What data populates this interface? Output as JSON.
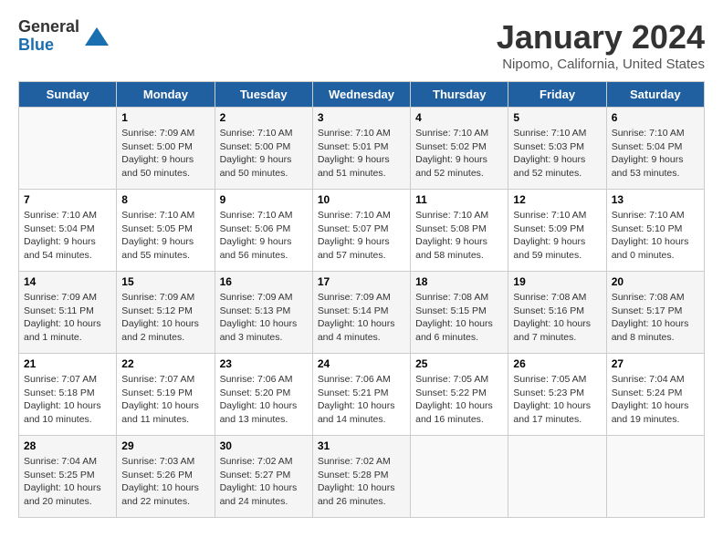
{
  "header": {
    "logo_general": "General",
    "logo_blue": "Blue",
    "month_title": "January 2024",
    "location": "Nipomo, California, United States"
  },
  "days_of_week": [
    "Sunday",
    "Monday",
    "Tuesday",
    "Wednesday",
    "Thursday",
    "Friday",
    "Saturday"
  ],
  "weeks": [
    [
      {
        "day": "",
        "sunrise": "",
        "sunset": "",
        "daylight": ""
      },
      {
        "day": "1",
        "sunrise": "Sunrise: 7:09 AM",
        "sunset": "Sunset: 5:00 PM",
        "daylight": "Daylight: 9 hours and 50 minutes."
      },
      {
        "day": "2",
        "sunrise": "Sunrise: 7:10 AM",
        "sunset": "Sunset: 5:00 PM",
        "daylight": "Daylight: 9 hours and 50 minutes."
      },
      {
        "day": "3",
        "sunrise": "Sunrise: 7:10 AM",
        "sunset": "Sunset: 5:01 PM",
        "daylight": "Daylight: 9 hours and 51 minutes."
      },
      {
        "day": "4",
        "sunrise": "Sunrise: 7:10 AM",
        "sunset": "Sunset: 5:02 PM",
        "daylight": "Daylight: 9 hours and 52 minutes."
      },
      {
        "day": "5",
        "sunrise": "Sunrise: 7:10 AM",
        "sunset": "Sunset: 5:03 PM",
        "daylight": "Daylight: 9 hours and 52 minutes."
      },
      {
        "day": "6",
        "sunrise": "Sunrise: 7:10 AM",
        "sunset": "Sunset: 5:04 PM",
        "daylight": "Daylight: 9 hours and 53 minutes."
      }
    ],
    [
      {
        "day": "7",
        "sunrise": "Sunrise: 7:10 AM",
        "sunset": "Sunset: 5:04 PM",
        "daylight": "Daylight: 9 hours and 54 minutes."
      },
      {
        "day": "8",
        "sunrise": "Sunrise: 7:10 AM",
        "sunset": "Sunset: 5:05 PM",
        "daylight": "Daylight: 9 hours and 55 minutes."
      },
      {
        "day": "9",
        "sunrise": "Sunrise: 7:10 AM",
        "sunset": "Sunset: 5:06 PM",
        "daylight": "Daylight: 9 hours and 56 minutes."
      },
      {
        "day": "10",
        "sunrise": "Sunrise: 7:10 AM",
        "sunset": "Sunset: 5:07 PM",
        "daylight": "Daylight: 9 hours and 57 minutes."
      },
      {
        "day": "11",
        "sunrise": "Sunrise: 7:10 AM",
        "sunset": "Sunset: 5:08 PM",
        "daylight": "Daylight: 9 hours and 58 minutes."
      },
      {
        "day": "12",
        "sunrise": "Sunrise: 7:10 AM",
        "sunset": "Sunset: 5:09 PM",
        "daylight": "Daylight: 9 hours and 59 minutes."
      },
      {
        "day": "13",
        "sunrise": "Sunrise: 7:10 AM",
        "sunset": "Sunset: 5:10 PM",
        "daylight": "Daylight: 10 hours and 0 minutes."
      }
    ],
    [
      {
        "day": "14",
        "sunrise": "Sunrise: 7:09 AM",
        "sunset": "Sunset: 5:11 PM",
        "daylight": "Daylight: 10 hours and 1 minute."
      },
      {
        "day": "15",
        "sunrise": "Sunrise: 7:09 AM",
        "sunset": "Sunset: 5:12 PM",
        "daylight": "Daylight: 10 hours and 2 minutes."
      },
      {
        "day": "16",
        "sunrise": "Sunrise: 7:09 AM",
        "sunset": "Sunset: 5:13 PM",
        "daylight": "Daylight: 10 hours and 3 minutes."
      },
      {
        "day": "17",
        "sunrise": "Sunrise: 7:09 AM",
        "sunset": "Sunset: 5:14 PM",
        "daylight": "Daylight: 10 hours and 4 minutes."
      },
      {
        "day": "18",
        "sunrise": "Sunrise: 7:08 AM",
        "sunset": "Sunset: 5:15 PM",
        "daylight": "Daylight: 10 hours and 6 minutes."
      },
      {
        "day": "19",
        "sunrise": "Sunrise: 7:08 AM",
        "sunset": "Sunset: 5:16 PM",
        "daylight": "Daylight: 10 hours and 7 minutes."
      },
      {
        "day": "20",
        "sunrise": "Sunrise: 7:08 AM",
        "sunset": "Sunset: 5:17 PM",
        "daylight": "Daylight: 10 hours and 8 minutes."
      }
    ],
    [
      {
        "day": "21",
        "sunrise": "Sunrise: 7:07 AM",
        "sunset": "Sunset: 5:18 PM",
        "daylight": "Daylight: 10 hours and 10 minutes."
      },
      {
        "day": "22",
        "sunrise": "Sunrise: 7:07 AM",
        "sunset": "Sunset: 5:19 PM",
        "daylight": "Daylight: 10 hours and 11 minutes."
      },
      {
        "day": "23",
        "sunrise": "Sunrise: 7:06 AM",
        "sunset": "Sunset: 5:20 PM",
        "daylight": "Daylight: 10 hours and 13 minutes."
      },
      {
        "day": "24",
        "sunrise": "Sunrise: 7:06 AM",
        "sunset": "Sunset: 5:21 PM",
        "daylight": "Daylight: 10 hours and 14 minutes."
      },
      {
        "day": "25",
        "sunrise": "Sunrise: 7:05 AM",
        "sunset": "Sunset: 5:22 PM",
        "daylight": "Daylight: 10 hours and 16 minutes."
      },
      {
        "day": "26",
        "sunrise": "Sunrise: 7:05 AM",
        "sunset": "Sunset: 5:23 PM",
        "daylight": "Daylight: 10 hours and 17 minutes."
      },
      {
        "day": "27",
        "sunrise": "Sunrise: 7:04 AM",
        "sunset": "Sunset: 5:24 PM",
        "daylight": "Daylight: 10 hours and 19 minutes."
      }
    ],
    [
      {
        "day": "28",
        "sunrise": "Sunrise: 7:04 AM",
        "sunset": "Sunset: 5:25 PM",
        "daylight": "Daylight: 10 hours and 20 minutes."
      },
      {
        "day": "29",
        "sunrise": "Sunrise: 7:03 AM",
        "sunset": "Sunset: 5:26 PM",
        "daylight": "Daylight: 10 hours and 22 minutes."
      },
      {
        "day": "30",
        "sunrise": "Sunrise: 7:02 AM",
        "sunset": "Sunset: 5:27 PM",
        "daylight": "Daylight: 10 hours and 24 minutes."
      },
      {
        "day": "31",
        "sunrise": "Sunrise: 7:02 AM",
        "sunset": "Sunset: 5:28 PM",
        "daylight": "Daylight: 10 hours and 26 minutes."
      },
      {
        "day": "",
        "sunrise": "",
        "sunset": "",
        "daylight": ""
      },
      {
        "day": "",
        "sunrise": "",
        "sunset": "",
        "daylight": ""
      },
      {
        "day": "",
        "sunrise": "",
        "sunset": "",
        "daylight": ""
      }
    ]
  ]
}
